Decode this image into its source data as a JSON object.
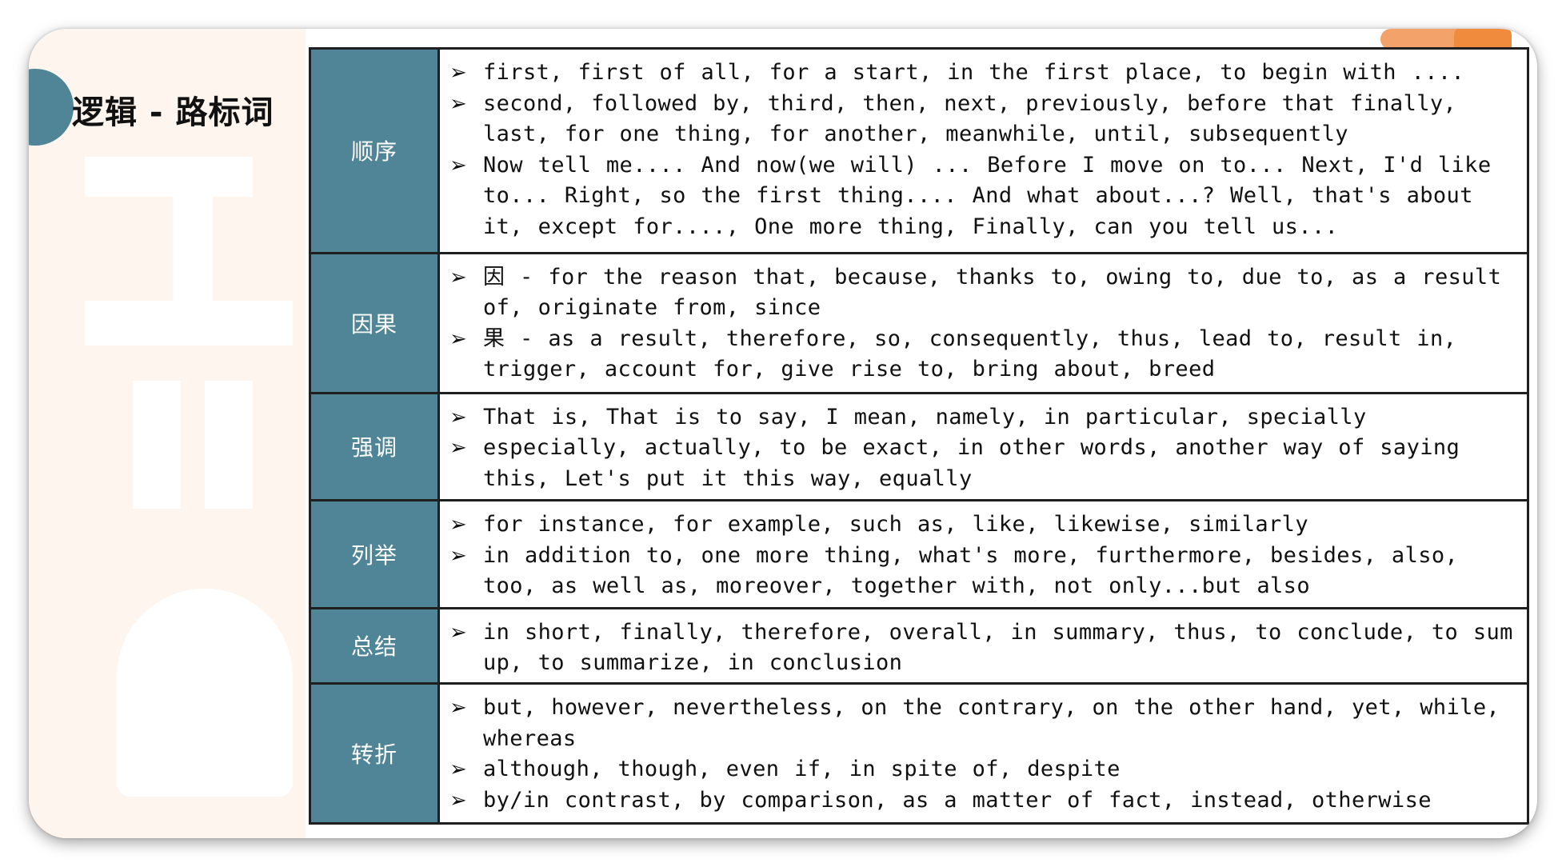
{
  "title": "逻辑 - 路标词",
  "rows": [
    {
      "category": "顺序",
      "items": [
        "first, first of all, for a start, in the first place, to begin with ....",
        "second, followed by, third, then, next, previously, before that finally, last, for one thing, for another, meanwhile, until, subsequently",
        "Now tell me.... And now(we will) ... Before I move on to... Next, I'd like to... Right, so the first thing.... And what about...? Well, that's about it, except for...., One more thing, Finally, can you tell us..."
      ]
    },
    {
      "category": "因果",
      "items": [
        "因 - for the reason that, because, thanks to, owing to, due to, as a result of, originate from, since",
        "果 - as a result, therefore, so, consequently, thus, lead to, result in, trigger, account for, give rise to, bring about, breed"
      ]
    },
    {
      "category": "强调",
      "items": [
        "That is, That is to say, I mean, namely, in particular, specially",
        "especially, actually, to be exact, in other words, another way of saying this, Let's put it this way, equally"
      ]
    },
    {
      "category": "列举",
      "items": [
        "for instance, for example, such as, like, likewise, similarly",
        "in addition to, one more thing, what's more, furthermore, besides, also, too, as well as, moreover, together with, not only...but also"
      ]
    },
    {
      "category": "总结",
      "items": [
        "in short, finally, therefore, overall, in summary, thus, to conclude, to sum up, to summarize, in conclusion"
      ]
    },
    {
      "category": "转折",
      "items": [
        "but, however, nevertheless, on the contrary, on the other hand, yet, while, whereas",
        "although, though, even if, in spite of, despite",
        "by/in contrast, by comparison, as a matter of fact, instead, otherwise"
      ]
    }
  ],
  "bullet_icon": "arrow-bullet-icon",
  "colors": {
    "category_bg": "#4f8596",
    "panel_bg": "#fef6ee",
    "accent": "#f08a3c"
  }
}
